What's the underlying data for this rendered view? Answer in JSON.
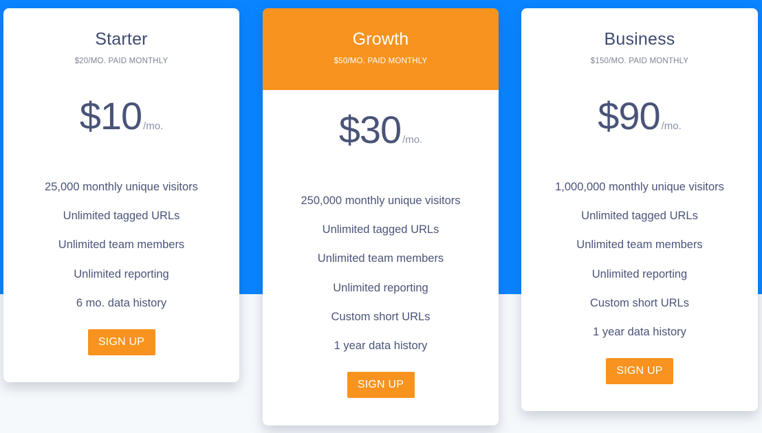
{
  "colors": {
    "hero_blue": "#0a84ff",
    "accent_orange": "#f7931e",
    "page_bg": "#f6f9fc",
    "text": "#4a5478"
  },
  "plans": [
    {
      "name": "Starter",
      "billing": "$20/MO. PAID MONTHLY",
      "price": "$10",
      "per": "/mo.",
      "featured": false,
      "features": [
        "25,000 monthly unique visitors",
        "Unlimited tagged URLs",
        "Unlimited team members",
        "Unlimited reporting",
        "6 mo. data history"
      ],
      "cta": "SIGN UP"
    },
    {
      "name": "Growth",
      "billing": "$50/MO. PAID MONTHLY",
      "price": "$30",
      "per": "/mo.",
      "featured": true,
      "features": [
        "250,000 monthly unique visitors",
        "Unlimited tagged URLs",
        "Unlimited team members",
        "Unlimited reporting",
        "Custom short URLs",
        "1 year data history"
      ],
      "cta": "SIGN UP"
    },
    {
      "name": "Business",
      "billing": "$150/MO. PAID MONTHLY",
      "price": "$90",
      "per": "/mo.",
      "featured": false,
      "features": [
        "1,000,000 monthly unique visitors",
        "Unlimited tagged URLs",
        "Unlimited team members",
        "Unlimited reporting",
        "Custom short URLs",
        "1 year data history"
      ],
      "cta": "SIGN UP"
    }
  ]
}
